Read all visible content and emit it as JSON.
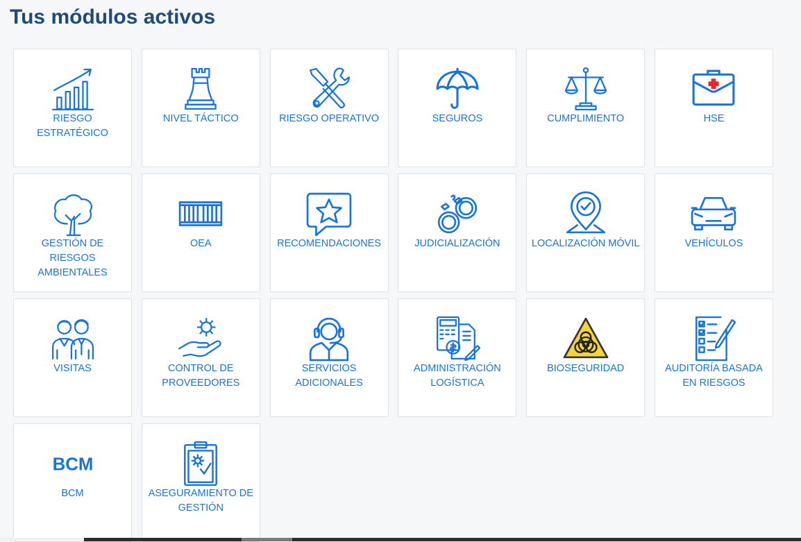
{
  "header": {
    "title": "Tus módulos activos"
  },
  "modules": [
    {
      "label": "RIESGO ESTRATÉGICO",
      "icon": "growth-chart-icon"
    },
    {
      "label": "NIVEL TÁCTICO",
      "icon": "chess-rook-icon"
    },
    {
      "label": "RIESGO OPERATIVO",
      "icon": "tools-icon"
    },
    {
      "label": "SEGUROS",
      "icon": "umbrella-icon"
    },
    {
      "label": "CUMPLIMIENTO",
      "icon": "scales-icon"
    },
    {
      "label": "HSE",
      "icon": "first-aid-kit-icon"
    },
    {
      "label": "GESTIÓN DE RIESGOS AMBIENTALES",
      "icon": "tree-icon"
    },
    {
      "label": "OEA",
      "icon": "container-icon"
    },
    {
      "label": "RECOMENDACIONES",
      "icon": "star-message-icon"
    },
    {
      "label": "JUDICIALIZACIÓN",
      "icon": "handcuffs-icon"
    },
    {
      "label": "LOCALIZACIÓN MÓVIL",
      "icon": "location-pin-icon"
    },
    {
      "label": "VEHÍCULOS",
      "icon": "car-icon"
    },
    {
      "label": "VISITAS",
      "icon": "visitors-icon"
    },
    {
      "label": "CONTROL DE PROVEEDORES",
      "icon": "hand-gear-icon"
    },
    {
      "label": "SERVICIOS ADICIONALES",
      "icon": "support-agent-icon"
    },
    {
      "label": "ADMINISTRACIÓN LOGÍSTICA",
      "icon": "calculator-invoice-icon"
    },
    {
      "label": "BIOSEGURIDAD",
      "icon": "biohazard-icon"
    },
    {
      "label": "AUDITORÍA BASADA EN RIESGOS",
      "icon": "checklist-icon"
    },
    {
      "label": "BCM",
      "icon": "bcm-text-icon",
      "icon_text": "BCM"
    },
    {
      "label": "ASEGURAMIENTO DE GESTIÓN",
      "icon": "clipboard-gear-icon"
    }
  ],
  "colors": {
    "accent": "#1a73d9",
    "title": "#214a78",
    "background": "#f6f7f9",
    "biohazard_yellow": "#f5d33b"
  }
}
